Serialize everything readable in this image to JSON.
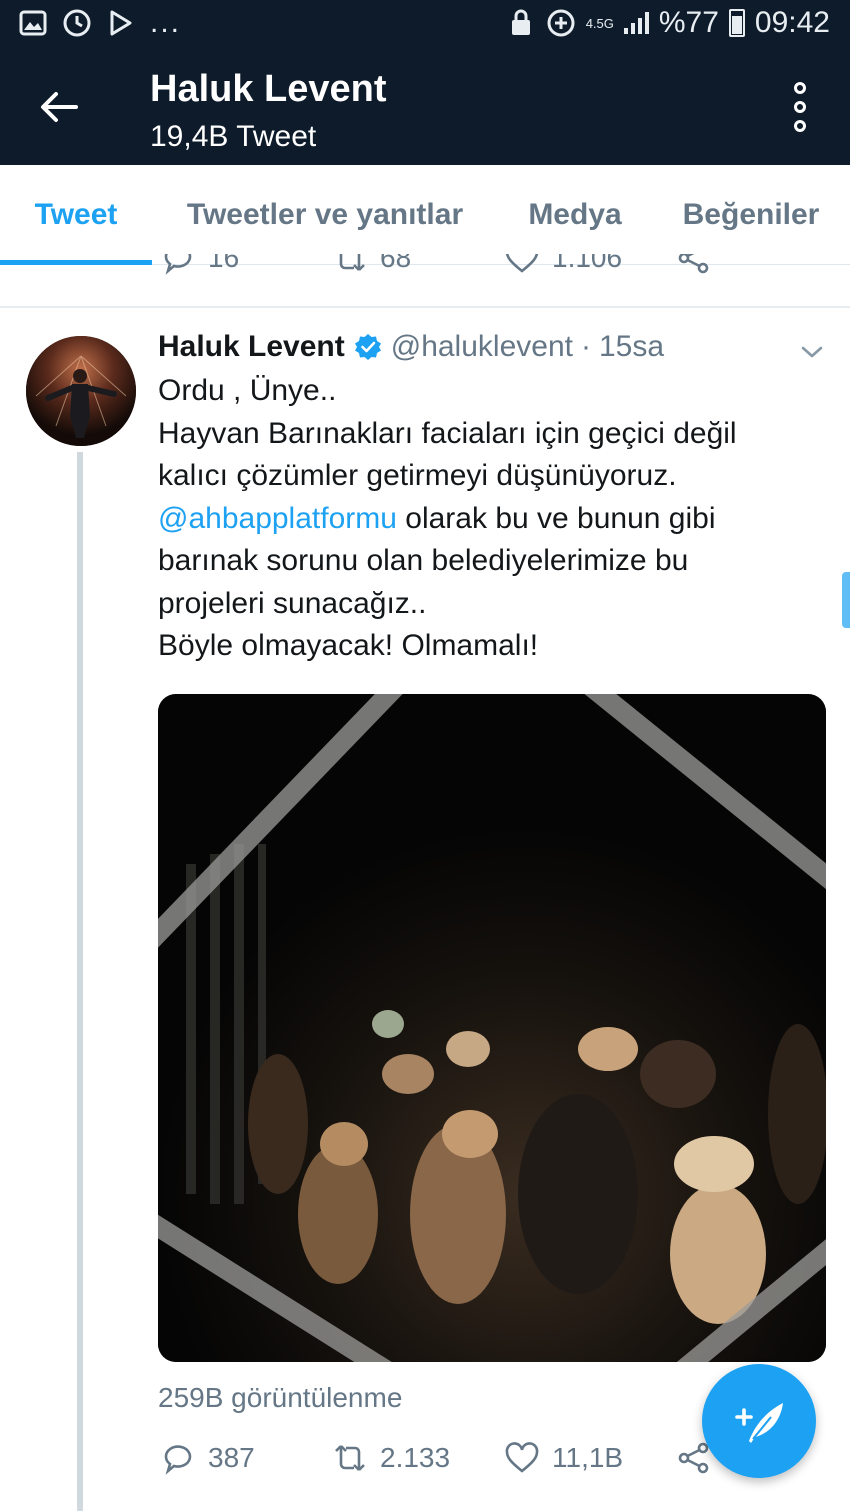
{
  "status_bar": {
    "network": "4.5G",
    "battery": "%77",
    "time": "09:42",
    "left_icons": [
      "gallery-icon",
      "clock-icon",
      "play-store-icon"
    ],
    "overflow": "..."
  },
  "app_bar": {
    "title": "Haluk Levent",
    "subtitle": "19,4B Tweet"
  },
  "tabs": [
    {
      "label": "Tweet",
      "active": true
    },
    {
      "label": "Tweetler ve yanıtlar",
      "active": false
    },
    {
      "label": "Medya",
      "active": false
    },
    {
      "label": "Beğeniler",
      "active": false
    }
  ],
  "previous_tweet_actions": {
    "replies": "16",
    "retweets": "68",
    "likes": "1.106"
  },
  "tweet": {
    "name": "Haluk Levent",
    "handle": "@haluklevent",
    "separator": "·",
    "time": "15sa",
    "lines": [
      "Ordu , Ünye..",
      "Hayvan Barınakları faciaları için geçici değil",
      "kalıcı çözümler getirmeyi düşünüyoruz."
    ],
    "mention": "@ahbapplatformu",
    "after_mention": " olarak bu ve bunun gibi",
    "lines2": [
      "barınak sorunu olan belediyelerimize bu",
      "projeleri sunacağız..",
      "Böyle olmayacak! Olmamalı!"
    ],
    "views": "259B görüntülenme",
    "replies": "387",
    "retweets": "2.133",
    "likes": "11,1B"
  },
  "colors": {
    "header_bg": "#0d1b2a",
    "accent": "#1da1f2",
    "muted": "#657786",
    "text": "#14171a"
  }
}
